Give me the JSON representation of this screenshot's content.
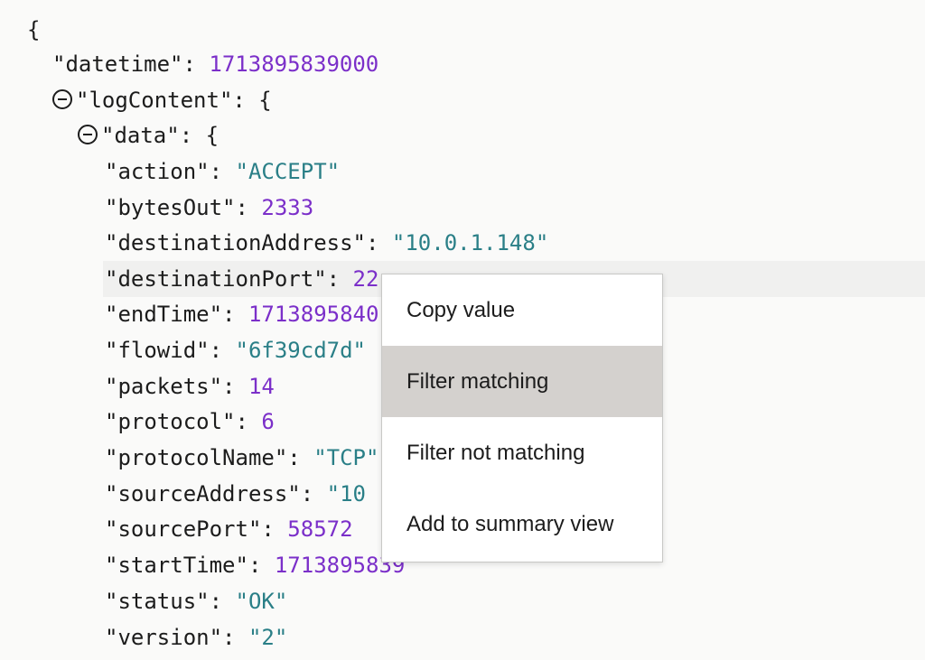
{
  "json_viewer": {
    "open_brace": "{",
    "datetime": {
      "key": "\"datetime\"",
      "sep": ": ",
      "value": "1713895839000"
    },
    "logContent": {
      "key": "\"logContent\"",
      "sep": ": ",
      "open": "{"
    },
    "data": {
      "key": "\"data\"",
      "sep": ": ",
      "open": "{"
    },
    "fields": [
      {
        "key": "\"action\"",
        "sep": ": ",
        "value": "\"ACCEPT\""
      },
      {
        "key": "\"bytesOut\"",
        "sep": ": ",
        "value": "2333"
      },
      {
        "key": "\"destinationAddress\"",
        "sep": ": ",
        "value": "\"10.0.1.148\""
      },
      {
        "key": "\"destinationPort\"",
        "sep": ": ",
        "value": "22"
      },
      {
        "key": "\"endTime\"",
        "sep": ": ",
        "value": "1713895840"
      },
      {
        "key": "\"flowid\"",
        "sep": ": ",
        "value": "\"6f39cd7d\""
      },
      {
        "key": "\"packets\"",
        "sep": ": ",
        "value": "14"
      },
      {
        "key": "\"protocol\"",
        "sep": ": ",
        "value": "6"
      },
      {
        "key": "\"protocolName\"",
        "sep": ": ",
        "value": "\"TCP\""
      },
      {
        "key": "\"sourceAddress\"",
        "sep": ": ",
        "value": "\"10"
      },
      {
        "key": "\"sourcePort\"",
        "sep": ": ",
        "value": "58572"
      },
      {
        "key": "\"startTime\"",
        "sep": ": ",
        "value": "1713895839"
      },
      {
        "key": "\"status\"",
        "sep": ": ",
        "value": "\"OK\""
      },
      {
        "key": "\"version\"",
        "sep": ": ",
        "value": "\"2\""
      }
    ]
  },
  "context_menu": {
    "items": [
      {
        "label": "Copy value"
      },
      {
        "label": "Filter matching"
      },
      {
        "label": "Filter not matching"
      },
      {
        "label": "Add to summary view"
      }
    ]
  },
  "colors": {
    "string_value": "#2a7f87",
    "number_value": "#7b2fc9",
    "menu_highlight": "#d4d1ce",
    "background": "#fafaf9"
  },
  "icons": {
    "collapse": "collapse-icon"
  }
}
